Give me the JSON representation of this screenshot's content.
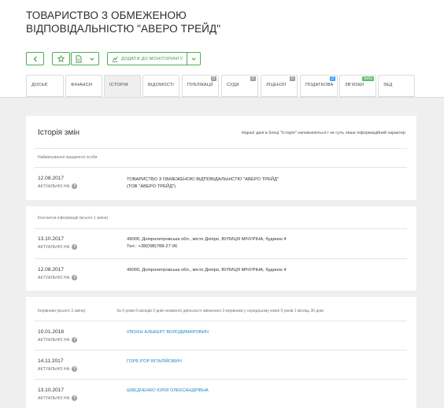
{
  "company": {
    "title": "ТОВАРИСТВО З ОБМЕЖЕНОЮ ВІДПОВІДАЛЬНІСТЮ \"АВЕРО ТРЕЙД\""
  },
  "toolbar": {
    "add_monitoring_label": "ДОДАТИ ДО МОНІТОРИНГУ"
  },
  "tabs": [
    {
      "label": "ДОСЬЄ",
      "badge": ""
    },
    {
      "label": "ФІНАНСИ",
      "badge": ""
    },
    {
      "label": "ІСТОРІЯ",
      "badge": ""
    },
    {
      "label": "ВІДОМОСТІ",
      "badge": ""
    },
    {
      "label": "ПУБЛІКАЦІЇ",
      "badge": "0"
    },
    {
      "label": "СУДИ",
      "badge": "0"
    },
    {
      "label": "ЛІЦЕНЗІЇ",
      "badge": "0"
    },
    {
      "label": "ПОДАТКОВА",
      "badge": "2"
    },
    {
      "label": "ЗВ'ЯЗКИ",
      "badge": "beta"
    },
    {
      "label": "ЗЕД",
      "badge": ""
    }
  ],
  "history": {
    "title": "Історія змін",
    "note": "Нараз! дані в блоці \"Історія\" наповнюються і не суть лише інформаційний характер",
    "name_section": {
      "label": "Найменування юридичної особи",
      "rows": [
        {
          "date": "12.08.2017",
          "status": "АКТУАЛЬНО НА",
          "value_line1": "ТОВАРИСТВО З ОБМЕЖЕНОЮ ВІДПОВІДАЛЬНІСТЮ \"АВЕРО ТРЕЙД\"",
          "value_line2": "(ТОВ \"АВЕРО ТРЕЙД\")"
        }
      ]
    },
    "contacts_section": {
      "label": "Контактна інформація (всього 1 зміна)",
      "rows": [
        {
          "date": "13.10.2017",
          "status": "АКТУАЛЬНО НА",
          "value_line1": "49000, Дніпропетровська обл., місто Дніпро, ВУЛИЦЯ МІЧУРІНА, будинок 4",
          "value_line2": "Тел.: +38(098)788-27-96"
        },
        {
          "date": "12.08.2017",
          "status": "АКТУАЛЬНО НА",
          "value_line1": "49000, Дніпропетровська обл., місто Дніпро, ВУЛИЦЯ МІЧУРІНА, будинок 4",
          "value_line2": ""
        }
      ]
    },
    "managers_section": {
      "label": "Керівники (всього 3 зміни)",
      "extra": "За 0 років 6 місяців 0 днів незмінної діяльності змінилися 3 керівники у середньому кожні 0 років 1 місяць 30 днів",
      "rows": [
        {
          "date": "10.01.2018",
          "status": "АКТУАЛЬНО НА",
          "value": "ІЛЮХІН АЛЬБЕРТ ВОЛОДИМИРОВИЧ"
        },
        {
          "date": "14.11.2017",
          "status": "АКТУАЛЬНО НА",
          "value": "ГОРБ ІГОР ВІТАЛІЙОВИЧ"
        },
        {
          "date": "13.10.2017",
          "status": "АКТУАЛЬНО НА",
          "value": "ШВЕДЧЕНКО ЮЛІЯ ОЛЕКСАНДРІВНА"
        }
      ]
    },
    "help_glyph": "?"
  }
}
